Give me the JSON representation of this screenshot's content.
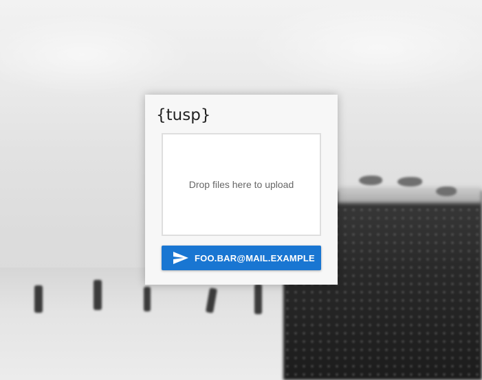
{
  "app": {
    "title": "{tusp}"
  },
  "dropzone": {
    "label": "Drop files here to upload"
  },
  "send_button": {
    "label": "FOO.BAR@MAIL.EXAMPLE",
    "icon": "send-icon",
    "color": "#1976d2"
  },
  "background": {
    "description_icon": "blurred-photo-background"
  }
}
